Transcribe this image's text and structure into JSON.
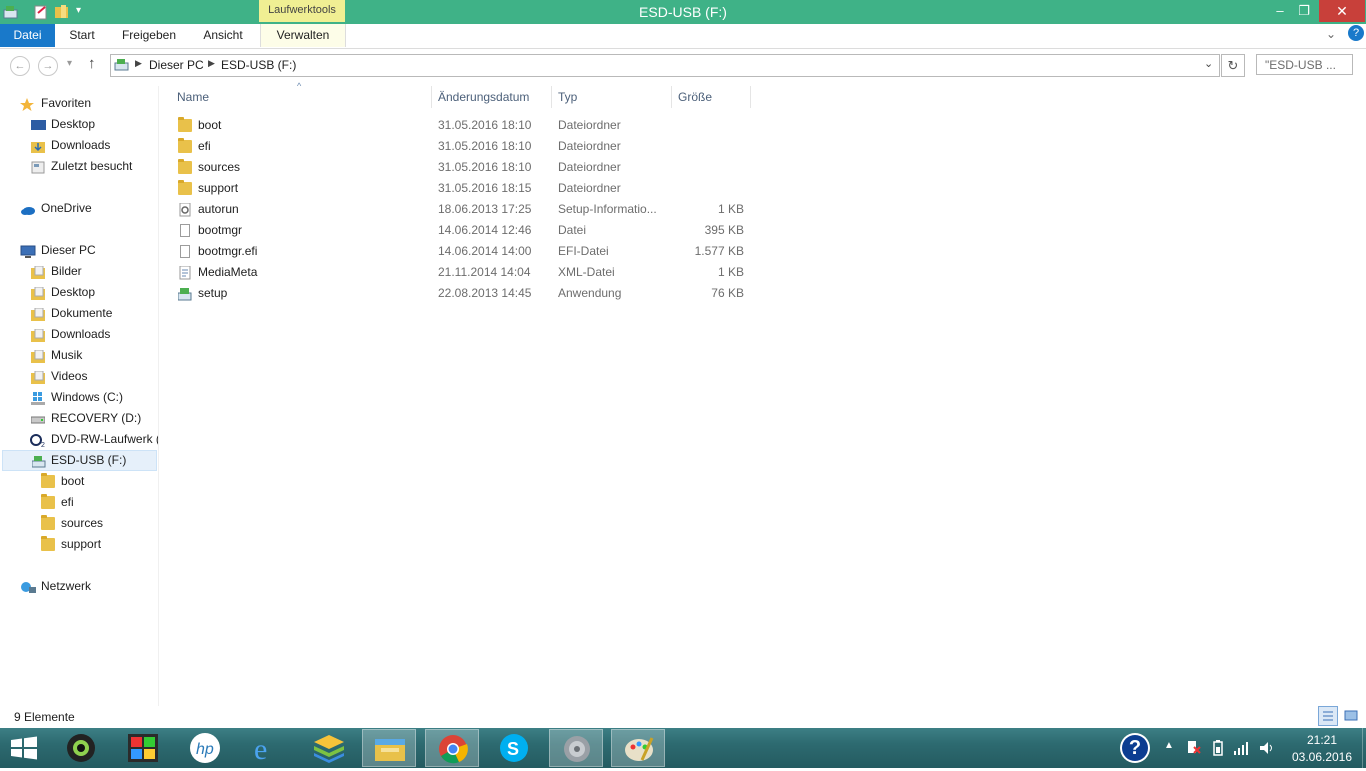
{
  "window": {
    "title": "ESD-USB (F:)",
    "context_tab": "Laufwerktools",
    "controls": {
      "minimize": "–",
      "restore": "❐",
      "close": "✕"
    }
  },
  "ribbon": {
    "tabs": [
      "Datei",
      "Start",
      "Freigeben",
      "Ansicht",
      "Verwalten"
    ]
  },
  "addressbar": {
    "breadcrumb": [
      "Dieser PC",
      "ESD-USB (F:)"
    ],
    "search_placeholder": "\"ESD-USB ..."
  },
  "sidebar": {
    "favorites": {
      "label": "Favoriten",
      "items": [
        "Desktop",
        "Downloads",
        "Zuletzt besucht"
      ]
    },
    "onedrive": "OneDrive",
    "thispc": {
      "label": "Dieser PC",
      "items": [
        "Bilder",
        "Desktop",
        "Dokumente",
        "Downloads",
        "Musik",
        "Videos",
        "Windows (C:)",
        "RECOVERY (D:)",
        "DVD-RW-Laufwerk (",
        "ESD-USB (F:)"
      ],
      "usb_children": [
        "boot",
        "efi",
        "sources",
        "support"
      ]
    },
    "network": "Netzwerk"
  },
  "columns": {
    "name": "Name",
    "date": "Änderungsdatum",
    "type": "Typ",
    "size": "Größe"
  },
  "files": [
    {
      "name": "boot",
      "date": "31.05.2016 18:10",
      "type": "Dateiordner",
      "size": "",
      "icon": "folder-icon"
    },
    {
      "name": "efi",
      "date": "31.05.2016 18:10",
      "type": "Dateiordner",
      "size": "",
      "icon": "folder-icon"
    },
    {
      "name": "sources",
      "date": "31.05.2016 18:10",
      "type": "Dateiordner",
      "size": "",
      "icon": "folder-icon"
    },
    {
      "name": "support",
      "date": "31.05.2016 18:15",
      "type": "Dateiordner",
      "size": "",
      "icon": "folder-icon"
    },
    {
      "name": "autorun",
      "date": "18.06.2013 17:25",
      "type": "Setup-Informatio...",
      "size": "1 KB",
      "icon": "settings-file-icon"
    },
    {
      "name": "bootmgr",
      "date": "14.06.2014 12:46",
      "type": "Datei",
      "size": "395 KB",
      "icon": "file-icon"
    },
    {
      "name": "bootmgr.efi",
      "date": "14.06.2014 14:00",
      "type": "EFI-Datei",
      "size": "1.577 KB",
      "icon": "file-icon"
    },
    {
      "name": "MediaMeta",
      "date": "21.11.2014 14:04",
      "type": "XML-Datei",
      "size": "1 KB",
      "icon": "xml-file-icon"
    },
    {
      "name": "setup",
      "date": "22.08.2013 14:45",
      "type": "Anwendung",
      "size": "76 KB",
      "icon": "setup-app-icon"
    }
  ],
  "status": {
    "count": "9 Elemente"
  },
  "taskbar": {
    "time": "21:21",
    "date": "03.06.2016"
  }
}
